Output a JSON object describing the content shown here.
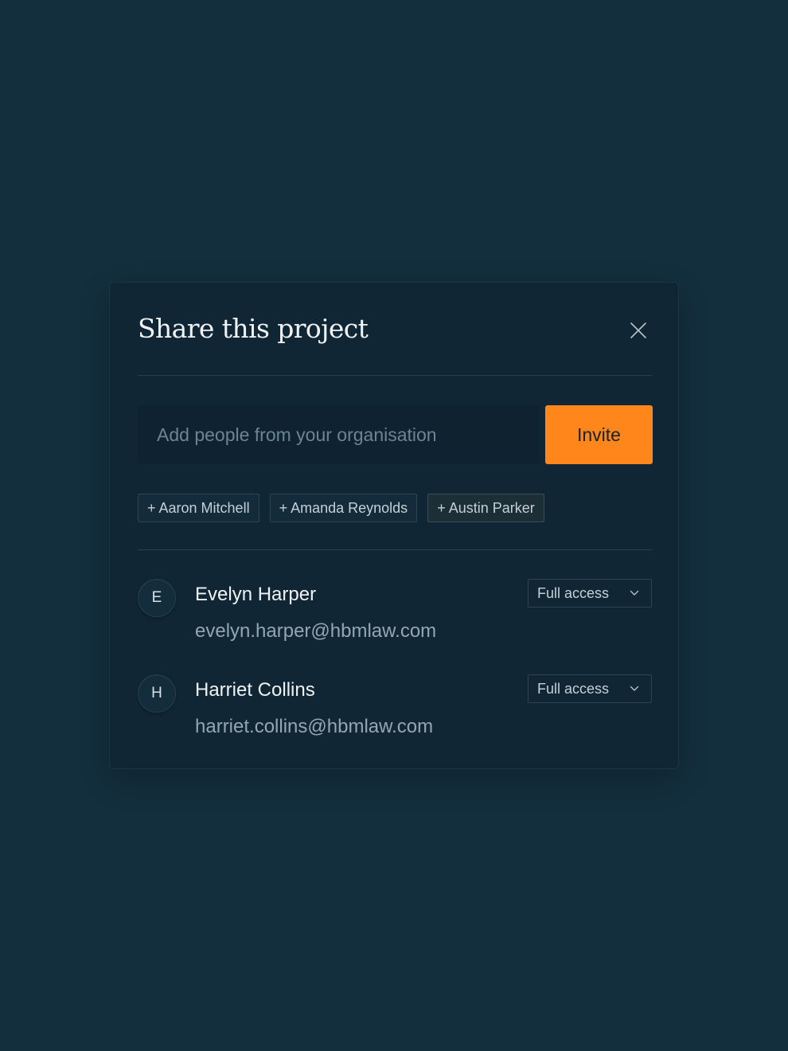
{
  "dialog": {
    "title": "Share this project",
    "close_icon": "close-icon"
  },
  "invite": {
    "placeholder": "Add people from your organisation",
    "value": "",
    "button_label": "Invite"
  },
  "suggestions": [
    {
      "label": "+ Aaron Mitchell"
    },
    {
      "label": "+ Amanda Reynolds"
    },
    {
      "label": "+ Austin Parker"
    }
  ],
  "members": [
    {
      "initial": "E",
      "name": "Evelyn Harper",
      "email": "evelyn.harper@hbmlaw.com",
      "access": "Full access",
      "access_icon": "chevron-down-icon"
    },
    {
      "initial": "H",
      "name": "Harriet Collins",
      "email": "harriet.collins@hbmlaw.com",
      "access": "Full access",
      "access_icon": "chevron-down-icon"
    }
  ],
  "colors": {
    "background": "#132e3d",
    "dialog": "#112634",
    "accent": "#ff861a"
  }
}
